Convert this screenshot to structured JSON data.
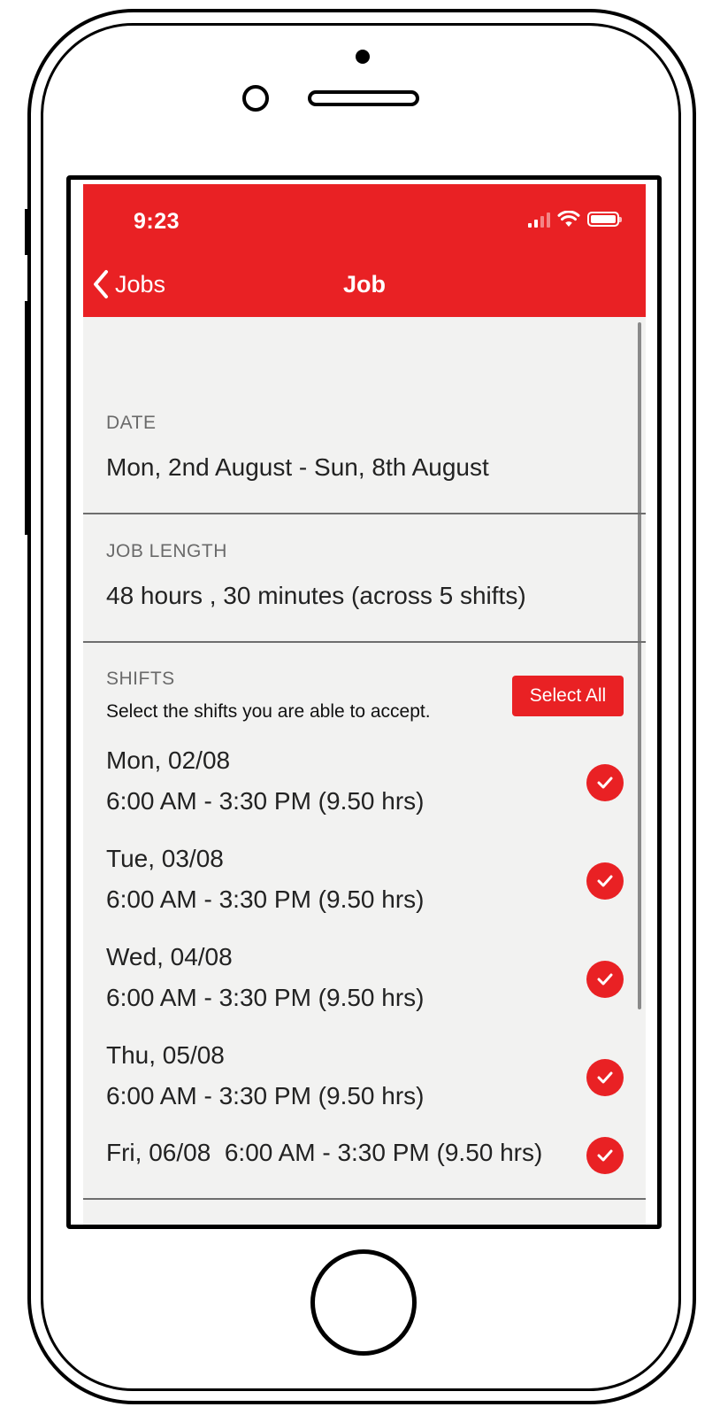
{
  "status_bar": {
    "time": "9:23"
  },
  "nav": {
    "back_label": "Jobs",
    "title": "Job"
  },
  "date_section": {
    "label": "DATE",
    "value": "Mon, 2nd August - Sun, 8th August"
  },
  "length_section": {
    "label": "JOB LENGTH",
    "value": "48 hours , 30 minutes (across 5 shifts)"
  },
  "shifts_section": {
    "label": "SHIFTS",
    "helper": "Select the shifts you are able to accept.",
    "select_all_label": "Select All",
    "shifts": [
      {
        "day": "Mon, 02/08",
        "time": "6:00 AM - 3:30 PM (9.50 hrs)",
        "selected": true
      },
      {
        "day": "Tue, 03/08",
        "time": "6:00 AM - 3:30 PM (9.50 hrs)",
        "selected": true
      },
      {
        "day": "Wed, 04/08",
        "time": "6:00 AM - 3:30 PM (9.50 hrs)",
        "selected": true
      },
      {
        "day": "Thu, 05/08",
        "time": "6:00 AM - 3:30 PM (9.50 hrs)",
        "selected": true
      },
      {
        "day": "Fri, 06/08",
        "time": "6:00 AM - 3:30 PM (9.50 hrs)",
        "selected": true
      }
    ]
  },
  "colors": {
    "brand_red": "#e92124",
    "background": "#f2f2f1"
  }
}
